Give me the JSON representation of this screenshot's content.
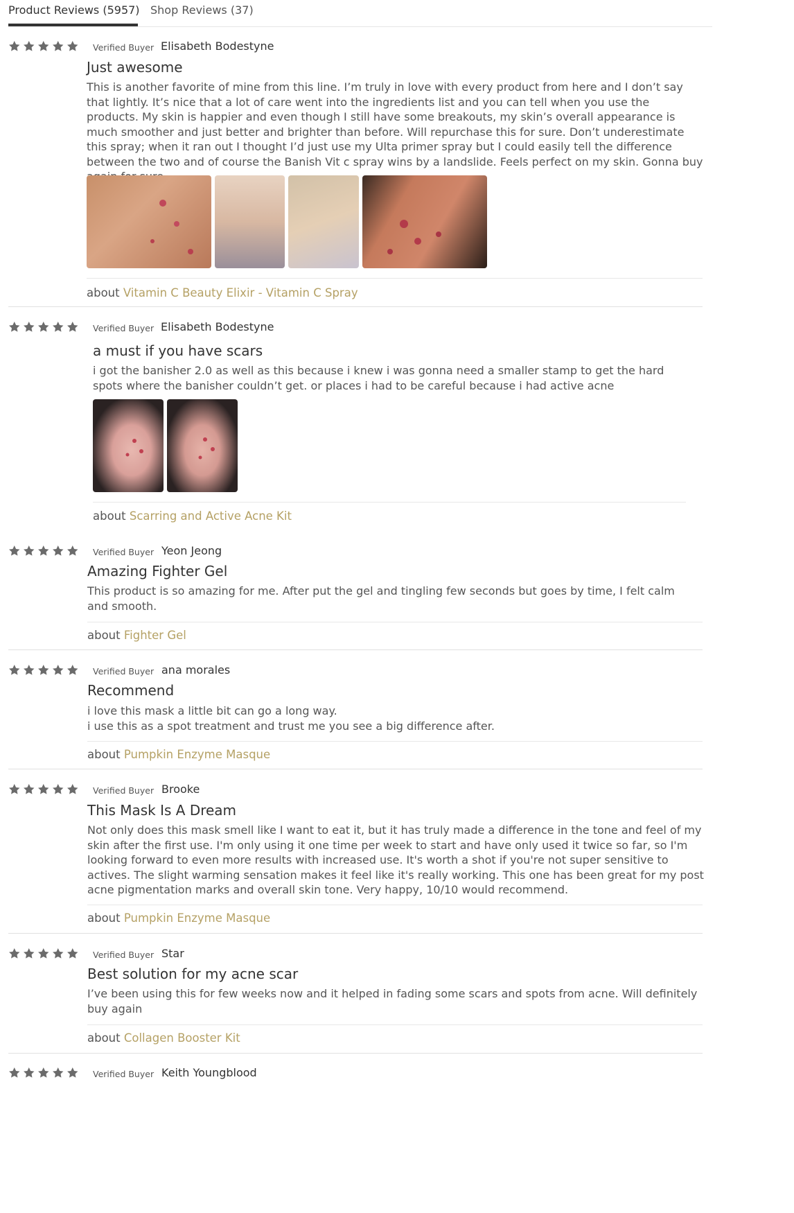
{
  "tabs": [
    {
      "label": "Product Reviews (5957)",
      "active": true
    },
    {
      "label": "Shop Reviews (37)",
      "active": false
    }
  ],
  "reviews": [
    {
      "rating": 5,
      "verified_label": "Verified Buyer",
      "author": "Elisabeth Bodestyne",
      "title": "Just awesome",
      "body": "This is another favorite of mine from this line. I’m truly in love with every product from here and I don’t say that lightly. It’s nice that a lot of care went into the ingredients list and you can tell when you use the products. My skin is happier and even though I still have some breakouts, my skin’s overall appearance is much smoother and just better and brighter than before. Will repurchase this for sure. Don’t underestimate this spray; when it ran out I thought I’d just use my Ulta primer spray but I could easily tell the difference between the two and of course the Banish Vit c spray wins by a landslide. Feels perfect on my skin. Gonna buy again for sure.",
      "photo_count": 4,
      "about_prefix": "about",
      "product_link": "Vitamin C Beauty Elixir - Vitamin C Spray"
    },
    {
      "rating": 5,
      "verified_label": "Verified Buyer",
      "author": "Elisabeth Bodestyne",
      "title": "a must if you have scars",
      "body": "i got the banisher 2.0 as well as this because i knew i was gonna need a smaller stamp to get the hard spots where the banisher couldn’t get. or places i had to be careful because i had active acne",
      "photo_count": 2,
      "about_prefix": "about",
      "product_link": "Scarring and Active Acne Kit"
    },
    {
      "rating": 5,
      "verified_label": "Verified Buyer",
      "author": "Yeon Jeong",
      "title": "Amazing Fighter Gel",
      "body": "This product is so amazing for me. After put the gel and tingling few seconds but goes by time, I felt calm and smooth.",
      "about_prefix": "about",
      "product_link": "Fighter Gel"
    },
    {
      "rating": 5,
      "verified_label": "Verified Buyer",
      "author": "ana morales",
      "title": "Recommend",
      "body_line1": "i love this mask a little bit can go a long way.",
      "body_line2": "i use this as a spot treatment and trust me you see a big difference after.",
      "about_prefix": "about",
      "product_link": "Pumpkin Enzyme Masque"
    },
    {
      "rating": 5,
      "verified_label": "Verified Buyer",
      "author": "Brooke",
      "title": "This Mask Is A Dream",
      "body": "Not only does this mask smell like I want to eat it, but it has truly made a difference in the tone and feel of my skin after the first use. I'm only using it one time per week to start and have only used it twice so far, so I'm looking forward to even more results with increased use. It's worth a shot if you're not super sensitive to actives. The slight warming sensation makes it feel like it's really working. This one has been great for my post acne pigmentation marks and overall skin tone. Very happy, 10/10 would recommend.",
      "about_prefix": "about",
      "product_link": "Pumpkin Enzyme Masque"
    },
    {
      "rating": 5,
      "verified_label": "Verified Buyer",
      "author": "Star",
      "title": "Best solution for my acne scar",
      "body": "I’ve been using this for few weeks now and it helped in fading some scars and spots from acne. Will definitely buy again",
      "about_prefix": "about",
      "product_link": "Collagen Booster Kit"
    },
    {
      "rating": 5,
      "verified_label": "Verified Buyer",
      "author": "Keith Youngblood"
    }
  ],
  "colors": {
    "star": "#6b6b6b",
    "link": "#b5a165",
    "divider": "#e0e0e0"
  },
  "icons": {
    "star": "star-icon"
  }
}
